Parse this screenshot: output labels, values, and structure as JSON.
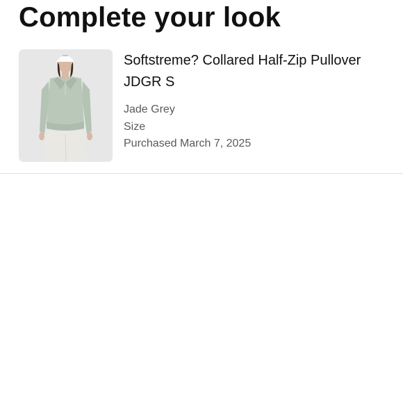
{
  "section": {
    "title": "Complete your look"
  },
  "product": {
    "name": "Softstreme? Collared Half-Zip Pullover JDGR S",
    "color": "Jade Grey",
    "size_label": "Size",
    "purchased": "Purchased March 7, 2025",
    "image_icon": "product-photo",
    "image_alt": "Woman wearing jade grey collared half-zip pullover and white cap"
  },
  "colors": {
    "text_primary": "#111111",
    "text_secondary": "#5a5a5a",
    "divider": "#dedede",
    "garment": "#b9c7b8"
  }
}
